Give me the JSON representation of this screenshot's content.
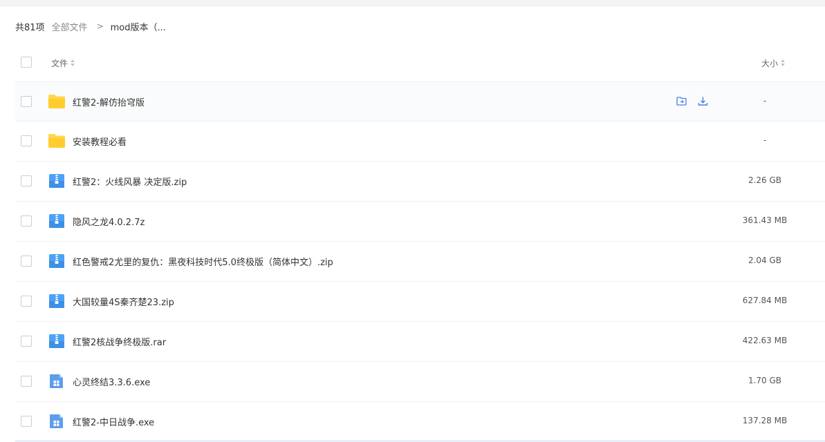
{
  "breadcrumb": {
    "count": "共81项",
    "all_files": "全部文件",
    "separator": ">",
    "current": "mod版本（..."
  },
  "header": {
    "name_col": "文件",
    "size_col": "大小"
  },
  "colors": {
    "folder": "#ffd74a",
    "zip": "#4da2f5",
    "exe": "#5c9ded",
    "action": "#4a7de8"
  },
  "files": [
    {
      "name": "红警2-解仿抬穹版",
      "size": "-",
      "type": "folder-icon",
      "hover": true,
      "actions": [
        "move-to-folder-icon",
        "download-icon"
      ]
    },
    {
      "name": "安装教程必看",
      "size": "-",
      "type": "folder-icon"
    },
    {
      "name": "红警2：火线风暴 决定版.zip",
      "size": "2.26 GB",
      "type": "zip-icon"
    },
    {
      "name": "隐风之龙4.0.2.7z",
      "size": "361.43 MB",
      "type": "zip-icon"
    },
    {
      "name": "红色警戒2尤里的复仇：黑夜科技时代5.0终极版（简体中文）.zip",
      "size": "2.04 GB",
      "type": "zip-icon"
    },
    {
      "name": "大国较量4S秦齐楚23.zip",
      "size": "627.84 MB",
      "type": "zip-icon"
    },
    {
      "name": "红警2核战争终极版.rar",
      "size": "422.63 MB",
      "type": "zip-icon"
    },
    {
      "name": "心灵终结3.3.6.exe",
      "size": "1.70 GB",
      "type": "exe-icon"
    },
    {
      "name": "红警2-中日战争.exe",
      "size": "137.28 MB",
      "type": "exe-icon"
    }
  ]
}
